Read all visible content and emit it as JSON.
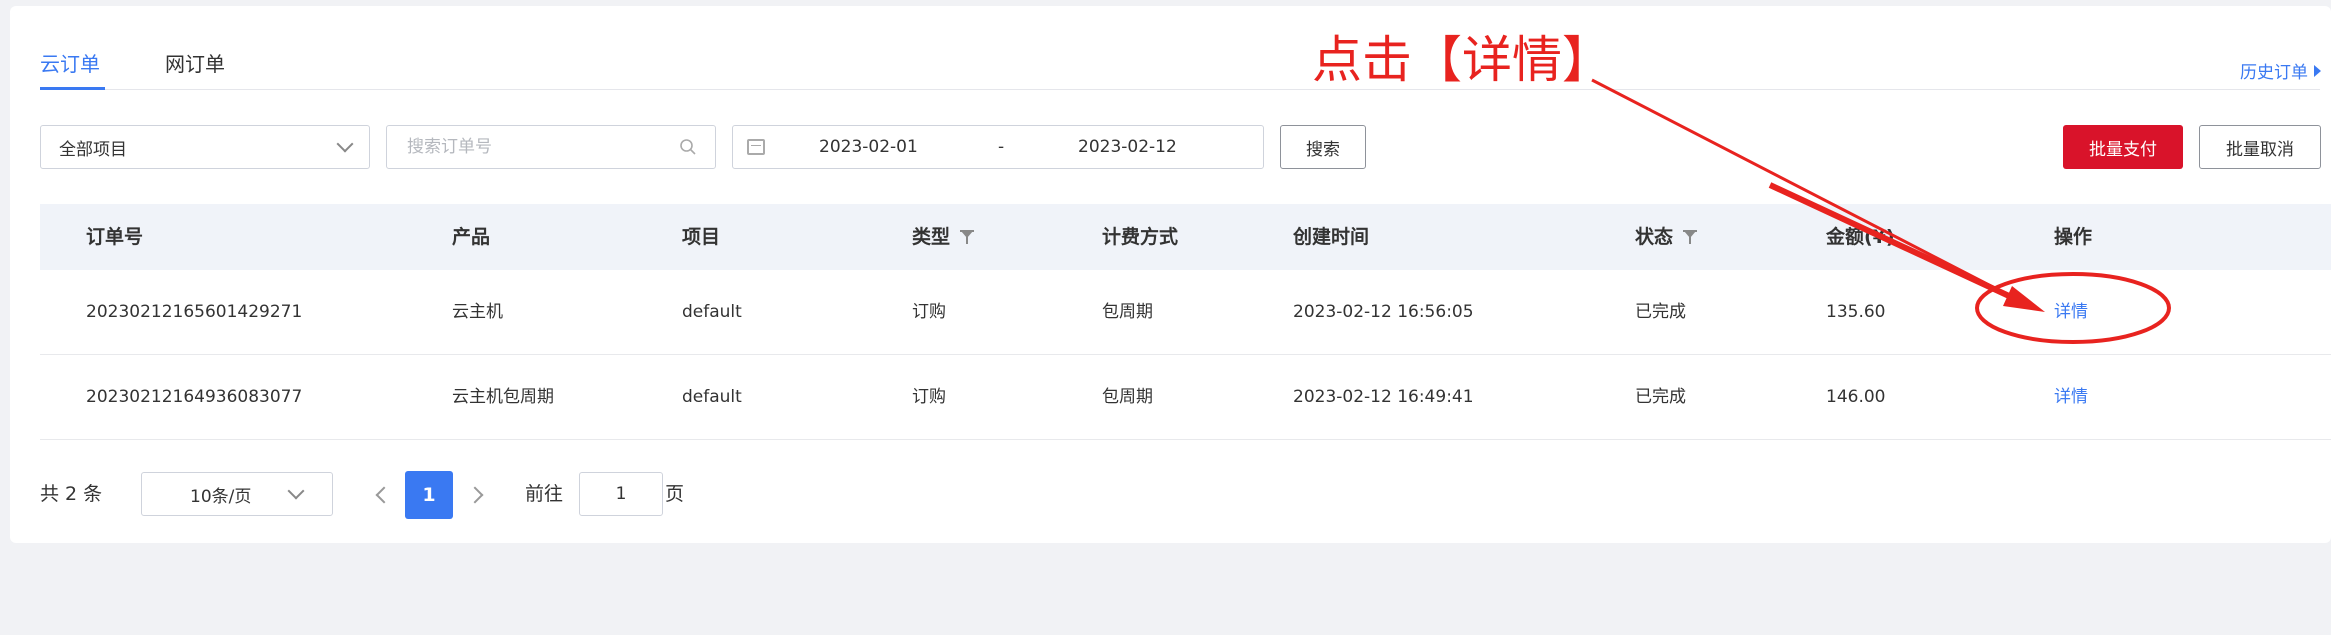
{
  "tabs": [
    {
      "label": "云订单",
      "active": true
    },
    {
      "label": "网订单",
      "active": false
    }
  ],
  "history_link": "历史订单",
  "filters": {
    "project_select": "全部项目",
    "search_placeholder": "搜索订单号",
    "date_start": "2023-02-01",
    "date_separator": "-",
    "date_end": "2023-02-12",
    "search_button": "搜索"
  },
  "actions": {
    "batch_pay": "批量支付",
    "batch_cancel": "批量取消"
  },
  "table": {
    "headers": [
      "订单号",
      "产品",
      "项目",
      "类型",
      "计费方式",
      "创建时间",
      "状态",
      "金额(¥)",
      "操作"
    ],
    "rows": [
      {
        "order_no": "20230212165601429271",
        "product": "云主机",
        "project": "default",
        "type": "订购",
        "billing": "包周期",
        "created": "2023-02-12 16:56:05",
        "status": "已完成",
        "amount": "135.60",
        "action": "详情"
      },
      {
        "order_no": "20230212164936083077",
        "product": "云主机包周期",
        "project": "default",
        "type": "订购",
        "billing": "包周期",
        "created": "2023-02-12 16:49:41",
        "status": "已完成",
        "amount": "146.00",
        "action": "详情"
      }
    ]
  },
  "pagination": {
    "total_text": "共 2 条",
    "page_size": "10条/页",
    "current_page": "1",
    "goto_label": "前往",
    "goto_value": "1",
    "page_suffix": "页"
  },
  "annotation": {
    "text": "点击【详情】",
    "color": "#e8231f"
  },
  "colors": {
    "accent": "#3a79f2",
    "danger": "#d9132a"
  }
}
